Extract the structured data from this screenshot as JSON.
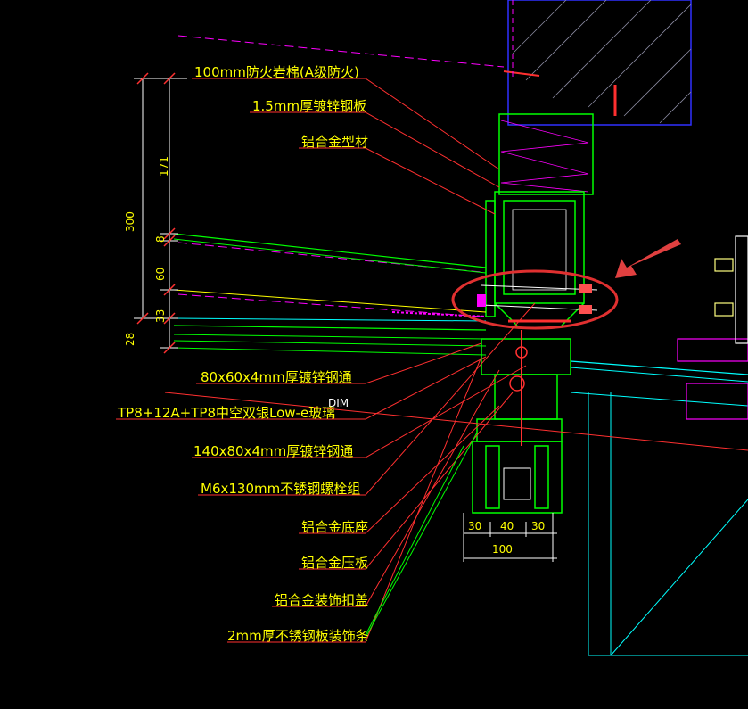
{
  "labels": {
    "rock_wool": "100mm防火岩棉(A级防火)",
    "galv_plate": "1.5mm厚镀锌钢板",
    "alu_profile": "铝合金型材",
    "steel_tube_80": "80x60x4mm厚镀锌钢通",
    "glass": "TP8+12A+TP8中空双银Low-e玻璃",
    "steel_tube_140": "140x80x4mm厚镀锌钢通",
    "bolt": "M6x130mm不锈钢螺栓组",
    "alu_base": "铝合金底座",
    "alu_press": "铝合金压板",
    "alu_cover": "铝合金装饰扣盖",
    "ss_strip": "2mm厚不锈钢板装饰条"
  },
  "dims_vertical": {
    "total": "300",
    "d171": "171",
    "d8": "8",
    "d60": "60",
    "d33": "33",
    "d28": "28"
  },
  "dim_tag": "DIM",
  "dims_bottom": {
    "d30a": "30",
    "d40": "40",
    "d30b": "30",
    "d100": "100"
  },
  "colors": {
    "background": "#000000",
    "label_text": "#ffff00",
    "leader_line": "#ff0000",
    "profile_green": "#00ff00",
    "glass_cyan": "#00ffff",
    "wall_blue": "#3030ff",
    "magenta": "#ff00ff",
    "highlight_ring": "#e03030"
  }
}
